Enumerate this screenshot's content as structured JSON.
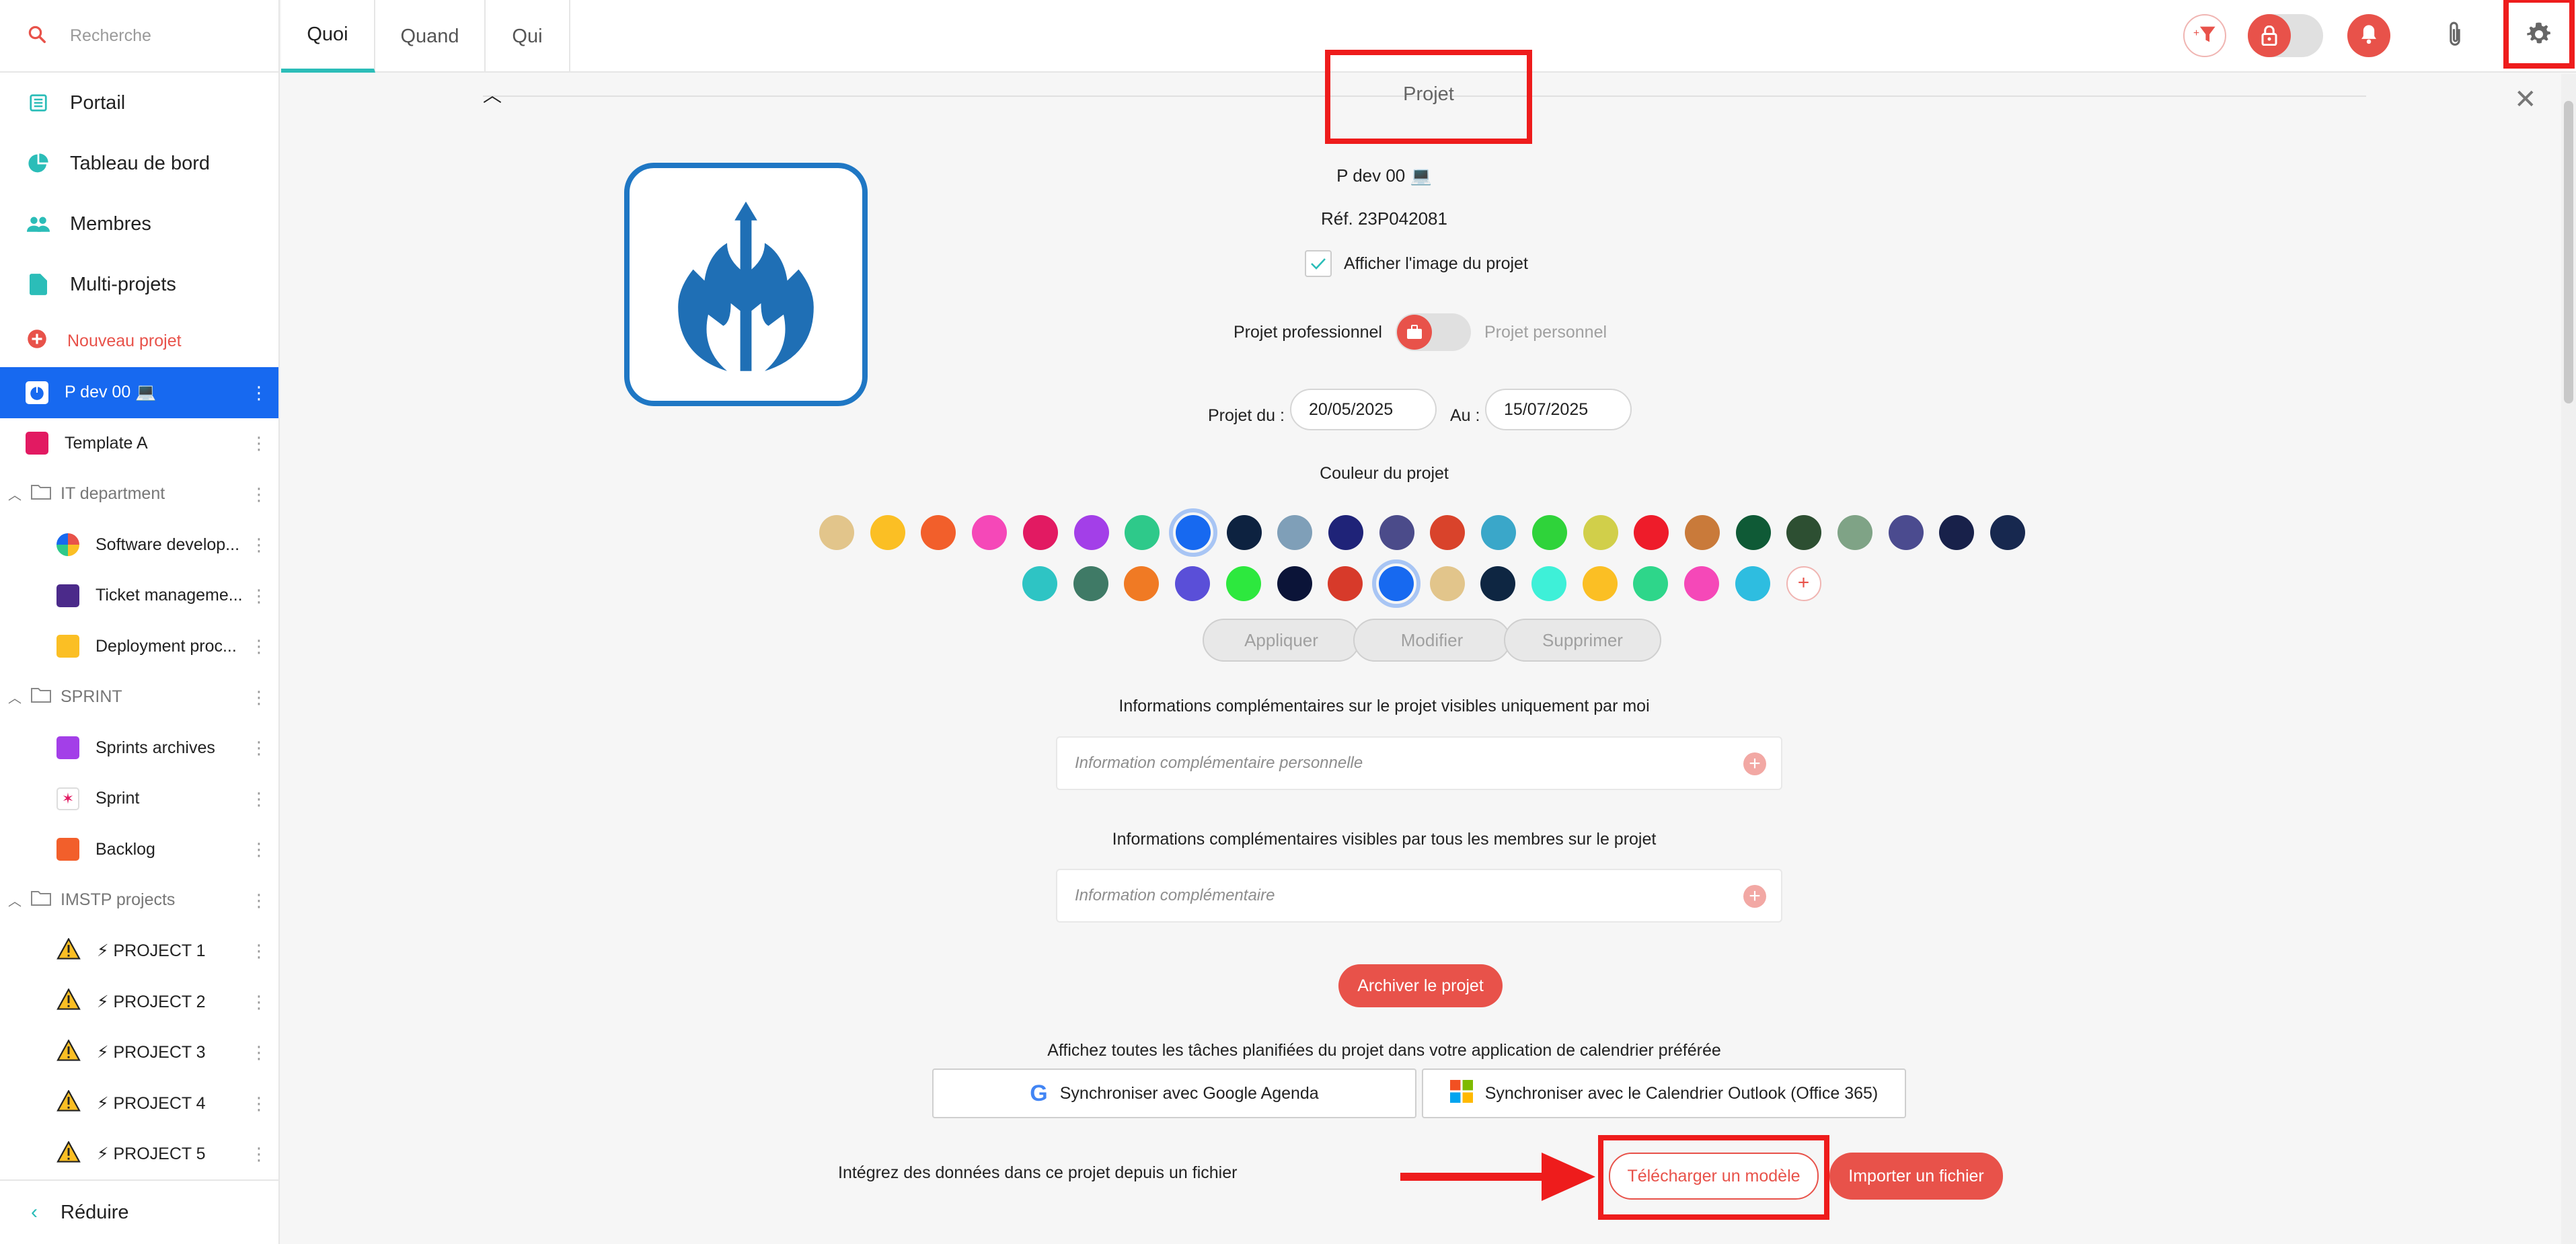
{
  "search": {
    "placeholder": "Recherche"
  },
  "nav": [
    {
      "label": "Portail"
    },
    {
      "label": "Tableau de bord"
    },
    {
      "label": "Membres"
    },
    {
      "label": "Multi-projets"
    }
  ],
  "new_project": "Nouveau projet",
  "tree": {
    "active_project": "P dev 00 💻",
    "template": "Template A",
    "groups": [
      {
        "label": "IT department",
        "items": [
          "Software develop...",
          "Ticket manageme...",
          "Deployment proc..."
        ]
      },
      {
        "label": "SPRINT",
        "items": [
          "Sprints archives",
          "Sprint",
          "Backlog"
        ]
      },
      {
        "label": "IMSTP projects",
        "items": [
          "⚡ PROJECT 1",
          "⚡ PROJECT 2",
          "⚡ PROJECT 3",
          "⚡ PROJECT 4",
          "⚡ PROJECT 5"
        ]
      }
    ]
  },
  "reduce_label": "Réduire",
  "tabs": [
    "Quoi",
    "Quand",
    "Qui"
  ],
  "colors": {
    "accent_red": "#e8524a",
    "active_blue": "#1769f0",
    "tab_teal": "#2bbdb8",
    "palette_row1": [
      "#e2c58b",
      "#fbbf24",
      "#f25f2b",
      "#f548b8",
      "#e21a62",
      "#a33fe8",
      "#2ec98a",
      "#1769f0",
      "#0d2240",
      "#7f9fb8",
      "#1f2378",
      "#4b4b8a",
      "#d9432b",
      "#3aa7c9",
      "#2fd33a",
      "#d1cf4a",
      "#ee1c2a",
      "#c97a3a",
      "#0f5a36",
      "#2d4f32",
      "#7fa386",
      "#4b4b8f",
      "#18214a",
      "#17284f"
    ],
    "palette_row2": [
      "#2ec4c4",
      "#3f7a66",
      "#f07a24",
      "#5a4fd8",
      "#2de83e",
      "#0b1438",
      "#d73a2a",
      "#1769f0",
      "#e2c58b",
      "#0e2642",
      "#3ef0d8",
      "#fbbf24",
      "#2ed68a",
      "#f548b8",
      "#2ebde0"
    ]
  },
  "project": {
    "section_title": "Projet",
    "name": "P dev 00 💻",
    "ref": "Réf. 23P042081",
    "show_image_label": "Afficher l'image du projet",
    "pro_label": "Projet professionnel",
    "perso_label": "Projet personnel",
    "from_label": "Projet du :",
    "from_value": "20/05/2025",
    "to_label": "Au :",
    "to_value": "15/07/2025",
    "color_label": "Couleur du projet",
    "btn_apply": "Appliquer",
    "btn_modify": "Modifier",
    "btn_delete": "Supprimer",
    "private_info_title": "Informations complémentaires sur le projet visibles uniquement par moi",
    "private_info_placeholder": "Information complémentaire personnelle",
    "public_info_title": "Informations complémentaires visibles par tous les membres sur le projet",
    "public_info_placeholder": "Information complémentaire",
    "archive_label": "Archiver le projet",
    "calendar_title": "Affichez toutes les tâches planifiées du projet dans votre application de calendrier préférée",
    "google_sync": "Synchroniser avec Google Agenda",
    "outlook_sync": "Synchroniser avec le Calendrier Outlook (Office 365)",
    "import_text": "Intégrez des données dans ce projet depuis un fichier",
    "download_template": "Télécharger un modèle",
    "import_file": "Importer un fichier"
  }
}
